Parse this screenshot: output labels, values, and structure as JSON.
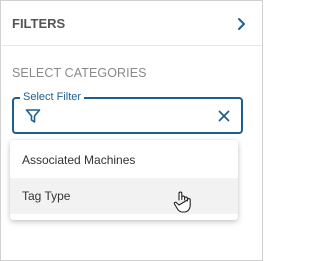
{
  "panel": {
    "title": "FILTERS",
    "collapse_icon": "chevron-right-icon",
    "section_label": "SELECT CATEGORIES",
    "filter_field": {
      "label": "Select Filter",
      "value": "",
      "placeholder": "",
      "leading_icon": "filter-icon",
      "trailing_icon": "close-icon"
    },
    "dropdown": {
      "options": [
        {
          "label": "Associated Machines",
          "hovered": false
        },
        {
          "label": "Tag Type",
          "hovered": true
        }
      ]
    }
  },
  "colors": {
    "accent": "#1f5f8f",
    "title_text": "#555555",
    "section_label_text": "#8a8a8a",
    "option_hover_bg": "#f2f2f2"
  },
  "pointer": {
    "icon": "hand-pointer-icon"
  }
}
